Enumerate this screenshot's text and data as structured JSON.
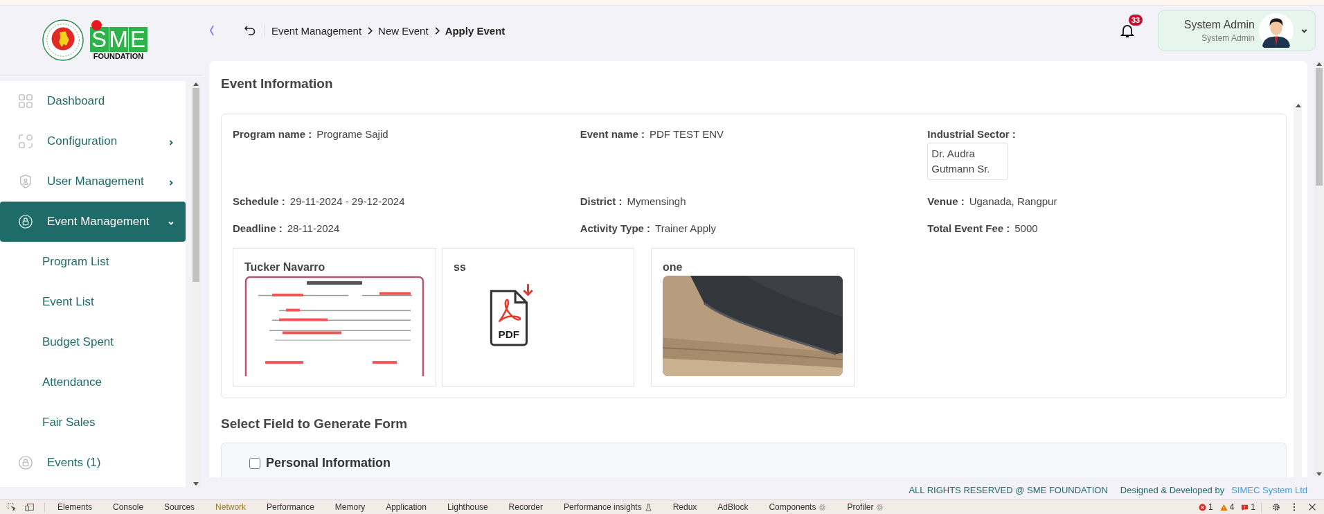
{
  "logo": {
    "letters": [
      "S",
      "M",
      "E"
    ],
    "tagline": "FOUNDATION"
  },
  "sidebar": {
    "items": [
      {
        "label": "Dashboard",
        "selected": false
      },
      {
        "label": "Configuration",
        "selected": false,
        "expanded": false
      },
      {
        "label": "User Management",
        "selected": false,
        "expanded": false
      },
      {
        "label": "Event Management",
        "selected": true,
        "expanded": true,
        "children": [
          {
            "label": "Program List",
            "selected": false
          },
          {
            "label": "Event List",
            "selected": false
          },
          {
            "label": "Budget Spent",
            "selected": false
          },
          {
            "label": "Attendance",
            "selected": false
          },
          {
            "label": "Fair Sales",
            "selected": false
          }
        ]
      },
      {
        "label": "Events (1)",
        "selected": false
      }
    ]
  },
  "header": {
    "breadcrumb": [
      {
        "label": "Event Management",
        "current": false
      },
      {
        "label": "New Event",
        "current": false
      },
      {
        "label": "Apply Event",
        "current": true
      }
    ],
    "notification_count": "33",
    "user": {
      "name": "System Admin",
      "role": "System Admin"
    }
  },
  "event_information": {
    "title": "Event Information",
    "fields": [
      {
        "label": "Program name :",
        "value": "Programe Sajid",
        "kind": "text"
      },
      {
        "label": "Event name :",
        "value": "PDF TEST ENV",
        "kind": "text"
      },
      {
        "label": "Industrial Sector :",
        "value": "Dr. Audra Gutmann Sr.",
        "kind": "box"
      },
      {
        "label": "Schedule :",
        "value": "29-11-2024 - 29-12-2024",
        "kind": "text"
      },
      {
        "label": "District :",
        "value": "Mymensingh",
        "kind": "text"
      },
      {
        "label": "Venue :",
        "value": "Uganada, Rangpur",
        "kind": "text"
      },
      {
        "label": "Deadline :",
        "value": "28-11-2024",
        "kind": "text"
      },
      {
        "label": "Activity Type :",
        "value": "Trainer Apply",
        "kind": "text"
      },
      {
        "label": "Total Event Fee :",
        "value": "5000",
        "kind": "text"
      }
    ],
    "attachments": [
      {
        "title": "Tucker Navarro",
        "kind": "document"
      },
      {
        "title": "ss",
        "kind": "pdf",
        "icon_label": "PDF"
      },
      {
        "title": "one"
      }
    ]
  },
  "form_section": {
    "title": "Select Field to Generate Form",
    "groups": [
      {
        "label": "Personal Information",
        "checked": false
      }
    ]
  },
  "footer": {
    "rights": "ALL RIGHTS RESERVED @ SME FOUNDATION",
    "designed_by": "Designed & Developed by",
    "company": "SIMEC System Ltd"
  },
  "devtools": {
    "tabs": [
      {
        "label": "Elements",
        "selected": false,
        "kind": "plain"
      },
      {
        "label": "Console",
        "selected": false,
        "kind": "plain"
      },
      {
        "label": "Sources",
        "selected": false,
        "kind": "plain"
      },
      {
        "label": "Network",
        "selected": true,
        "kind": "plain"
      },
      {
        "label": "Performance",
        "selected": false,
        "kind": "plain"
      },
      {
        "label": "Memory",
        "selected": false,
        "kind": "plain"
      },
      {
        "label": "Application",
        "selected": false,
        "kind": "plain"
      },
      {
        "label": "Lighthouse",
        "selected": false,
        "kind": "plain"
      },
      {
        "label": "Recorder",
        "selected": false,
        "kind": "plain"
      },
      {
        "label": "Performance insights",
        "selected": false,
        "kind": "experimental"
      },
      {
        "label": "Redux",
        "selected": false,
        "kind": "plain"
      },
      {
        "label": "AdBlock",
        "selected": false,
        "kind": "plain"
      },
      {
        "label": "Components",
        "selected": false,
        "kind": "react"
      },
      {
        "label": "Profiler",
        "selected": false,
        "kind": "react"
      }
    ],
    "errors": "1",
    "warnings": "4",
    "issues": "1"
  }
}
